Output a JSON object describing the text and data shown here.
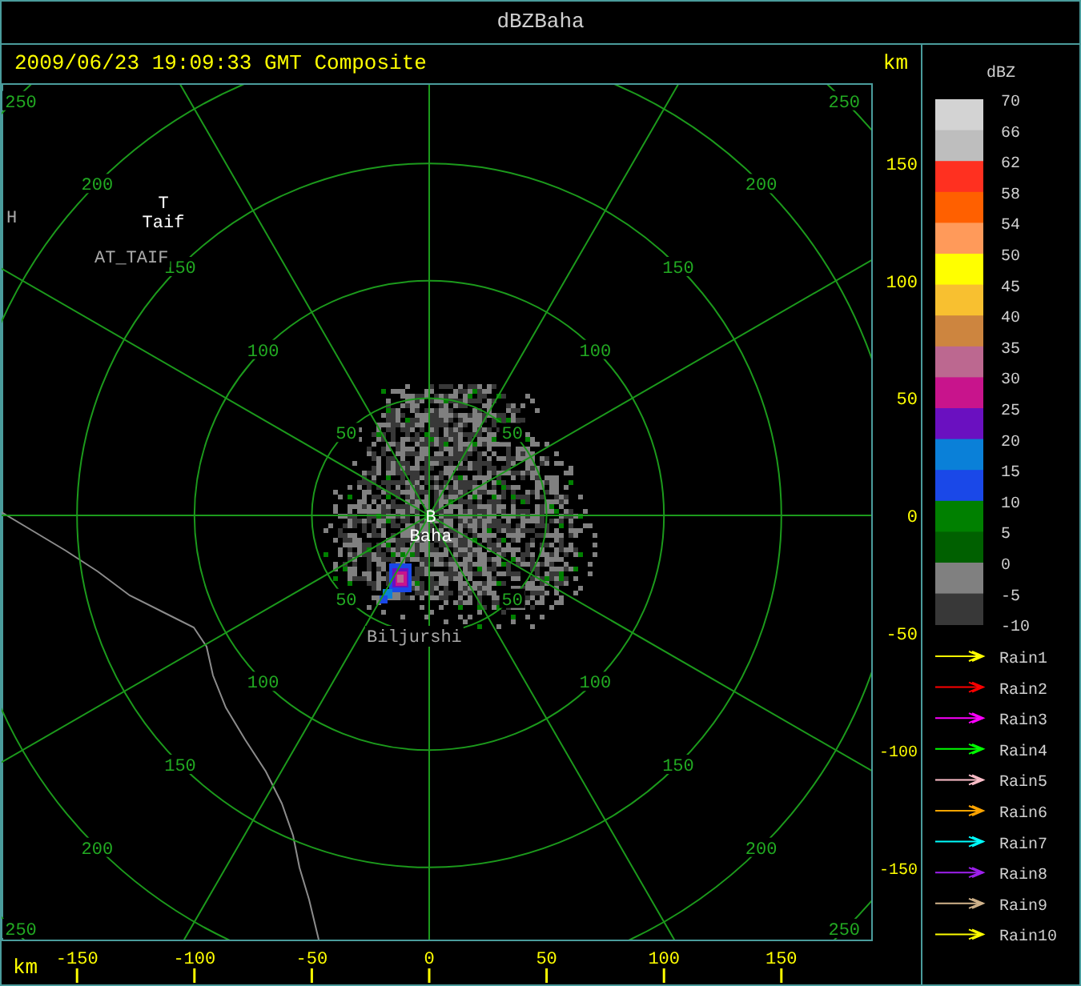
{
  "window": {
    "title": "dBZBaha"
  },
  "header": {
    "timestamp": "2009/06/23 19:09:33 GMT Composite",
    "unit": "km"
  },
  "map": {
    "range_rings": [
      {
        "labels": [
          "50",
          "50",
          "50",
          "50"
        ]
      },
      {
        "labels": [
          "100",
          "100",
          "100",
          "100"
        ]
      },
      {
        "labels": [
          "150",
          "150",
          "150",
          "150"
        ]
      },
      {
        "labels": [
          "200",
          "200",
          "200",
          "200"
        ]
      },
      {
        "labels": [
          "250",
          "250",
          "250",
          "250"
        ]
      }
    ],
    "sites": [
      {
        "marker": "T",
        "name": "Taif"
      },
      {
        "marker": "B",
        "name": "Baha"
      }
    ],
    "place_labels": [
      "AT_TAIF",
      "Biljurshi",
      "H"
    ]
  },
  "y_axis": {
    "ticks": [
      "150",
      "100",
      "50",
      "0",
      "-50",
      "-100",
      "-150"
    ]
  },
  "x_axis": {
    "unit": "km",
    "ticks": [
      "-150",
      "-100",
      "-50",
      "0",
      "50",
      "100",
      "150"
    ]
  },
  "legend": {
    "title": "dBZ",
    "scale_labels": [
      "70",
      "66",
      "62",
      "58",
      "54",
      "50",
      "45",
      "40",
      "35",
      "30",
      "25",
      "20",
      "15",
      "10",
      "5",
      "0",
      "-5",
      "-10"
    ],
    "bins": [
      {
        "color": "#d3d3d3"
      },
      {
        "color": "#bebebe"
      },
      {
        "color": "#ff3020"
      },
      {
        "color": "#ff6000"
      },
      {
        "color": "#ff9a5a"
      },
      {
        "color": "#ffff00"
      },
      {
        "color": "#f8c030"
      },
      {
        "color": "#cd853f"
      },
      {
        "color": "#bc6890"
      },
      {
        "color": "#c8148c"
      },
      {
        "color": "#6a10c0"
      },
      {
        "color": "#0a80d8"
      },
      {
        "color": "#1a48e8"
      },
      {
        "color": "#008000"
      },
      {
        "color": "#006000"
      },
      {
        "color": "#808080"
      },
      {
        "color": "#383838"
      }
    ],
    "tracks": [
      {
        "name": "Rain1",
        "color": "#ffff00"
      },
      {
        "name": "Rain2",
        "color": "#ff0000"
      },
      {
        "name": "Rain3",
        "color": "#ff00ff"
      },
      {
        "name": "Rain4",
        "color": "#00ff00"
      },
      {
        "name": "Rain5",
        "color": "#ffc0cb"
      },
      {
        "name": "Rain6",
        "color": "#ffa500"
      },
      {
        "name": "Rain7",
        "color": "#00ffff"
      },
      {
        "name": "Rain8",
        "color": "#a020f0"
      },
      {
        "name": "Rain9",
        "color": "#d2b48c"
      },
      {
        "name": "Rain10",
        "color": "#ffff00"
      }
    ]
  }
}
